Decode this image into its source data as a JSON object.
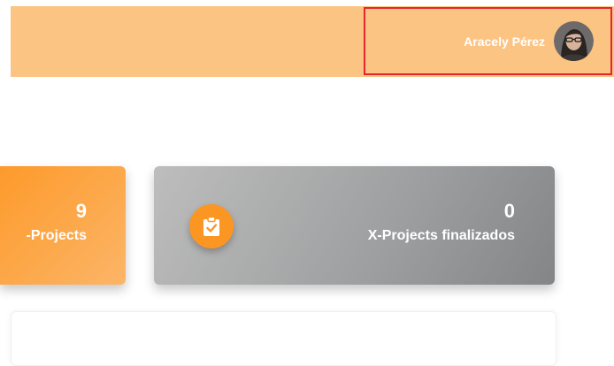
{
  "header": {
    "user_name": "Aracely Pérez",
    "background_color": "#fcc482",
    "highlight_color": "#e3262f"
  },
  "cards": [
    {
      "value": "9",
      "label": "-Projects",
      "color": "#fd9a2b"
    },
    {
      "value": "0",
      "label": "X-Projects finalizados",
      "icon": "clipboard-check-icon",
      "color": "#9d9e9f"
    }
  ]
}
